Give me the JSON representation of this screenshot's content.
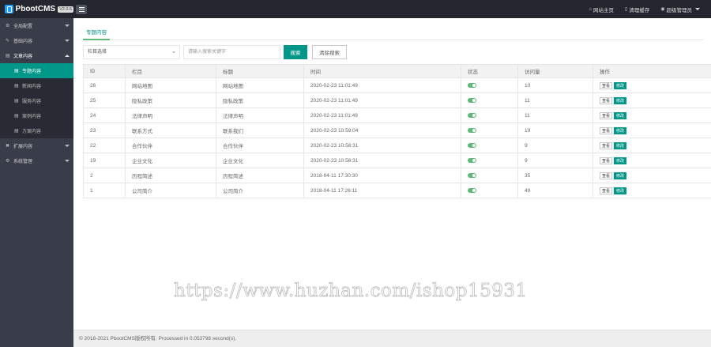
{
  "topbar": {
    "app_name": "PbootCMS",
    "version": "V2.0.6",
    "links": [
      {
        "icon": "home-icon",
        "glyph": "⌂",
        "label": "网站主页"
      },
      {
        "icon": "trash-icon",
        "glyph": "▯",
        "label": "清理缓存"
      },
      {
        "icon": "user-icon",
        "glyph": "◉",
        "label": "超级管理员"
      }
    ]
  },
  "sidebar": {
    "items": [
      {
        "label": "全局配置",
        "icon": "gear-icon",
        "glyph": "⚙"
      },
      {
        "label": "基础内容",
        "icon": "tag-icon",
        "glyph": "✎"
      },
      {
        "label": "文章内容",
        "icon": "file-icon",
        "glyph": "▤"
      },
      {
        "label": "扩展内容",
        "icon": "cross-icon",
        "glyph": "✖"
      },
      {
        "label": "系统管理",
        "icon": "gear-icon",
        "glyph": "⚙"
      }
    ],
    "sub_items": [
      {
        "label": "专题内容",
        "glyph": "▤"
      },
      {
        "label": "新闻内容",
        "glyph": "▤"
      },
      {
        "label": "服务内容",
        "glyph": "▤"
      },
      {
        "label": "案例内容",
        "glyph": "▤"
      },
      {
        "label": "方案内容",
        "glyph": "▤"
      }
    ]
  },
  "main": {
    "tab_label": "专题内容",
    "filters": {
      "select_value": "栏目选择",
      "search_placeholder": "请输入搜索关键字",
      "search_label": "搜索",
      "clear_label": "清除搜索"
    },
    "table": {
      "columns": [
        "ID",
        "栏目",
        "标题",
        "时间",
        "状态",
        "访问量",
        "操作"
      ],
      "view_label": "查看",
      "edit_label": "修改",
      "rows": [
        {
          "id": "26",
          "column": "网站地图",
          "title": "网站地图",
          "time": "2020-02-23 11:01:49",
          "views": "10"
        },
        {
          "id": "25",
          "column": "隐私政策",
          "title": "隐私政策",
          "time": "2020-02-23 11:01:49",
          "views": "11"
        },
        {
          "id": "24",
          "column": "法律声明",
          "title": "法律声明",
          "time": "2020-02-23 11:01:49",
          "views": "11"
        },
        {
          "id": "23",
          "column": "联系方式",
          "title": "联系我们",
          "time": "2020-02-23 10:59:04",
          "views": "19"
        },
        {
          "id": "22",
          "column": "合作伙伴",
          "title": "合作伙伴",
          "time": "2020-02-23 10:56:31",
          "views": "9"
        },
        {
          "id": "19",
          "column": "企业文化",
          "title": "企业文化",
          "time": "2020-02-23 10:56:31",
          "views": "9"
        },
        {
          "id": "2",
          "column": "历程简述",
          "title": "历程简述",
          "time": "2018-04-11 17:30:30",
          "views": "35"
        },
        {
          "id": "1",
          "column": "公司简介",
          "title": "公司简介",
          "time": "2018-04-11 17:26:11",
          "views": "49"
        }
      ]
    }
  },
  "watermark": "https://www.huzhan.com/ishop15931",
  "footer": "© 2018-2021 PbootCMS版权所有. Processed in 0.053798 second(s)."
}
